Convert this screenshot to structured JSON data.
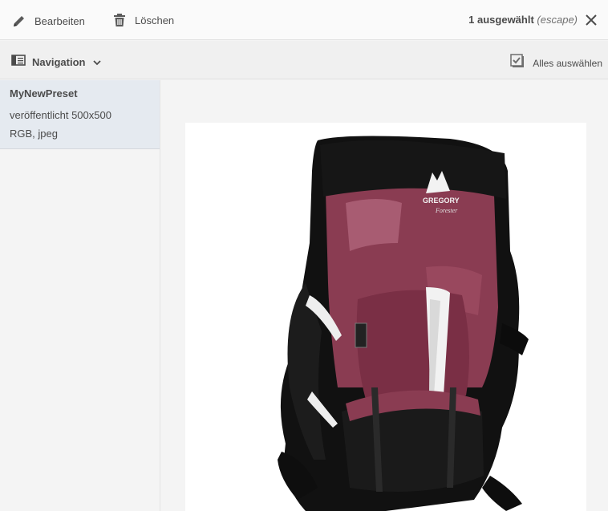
{
  "actionbar": {
    "edit_label": "Bearbeiten",
    "delete_label": "Löschen",
    "selection_count": "1 ausgewählt",
    "escape_hint": "(escape)"
  },
  "subbar": {
    "navigation_label": "Navigation",
    "select_all_label": "Alles auswählen"
  },
  "rail": {
    "items": [
      {
        "title": "MyNewPreset",
        "line1": "veröffentlicht 500x500",
        "line2": "RGB, jpeg"
      }
    ]
  },
  "preview": {
    "brand_logo_text": "GREGORY",
    "brand_script_text": "Forester"
  },
  "colors": {
    "accent_fabric": "#8a3c52",
    "fabric_dark": "#111111"
  }
}
